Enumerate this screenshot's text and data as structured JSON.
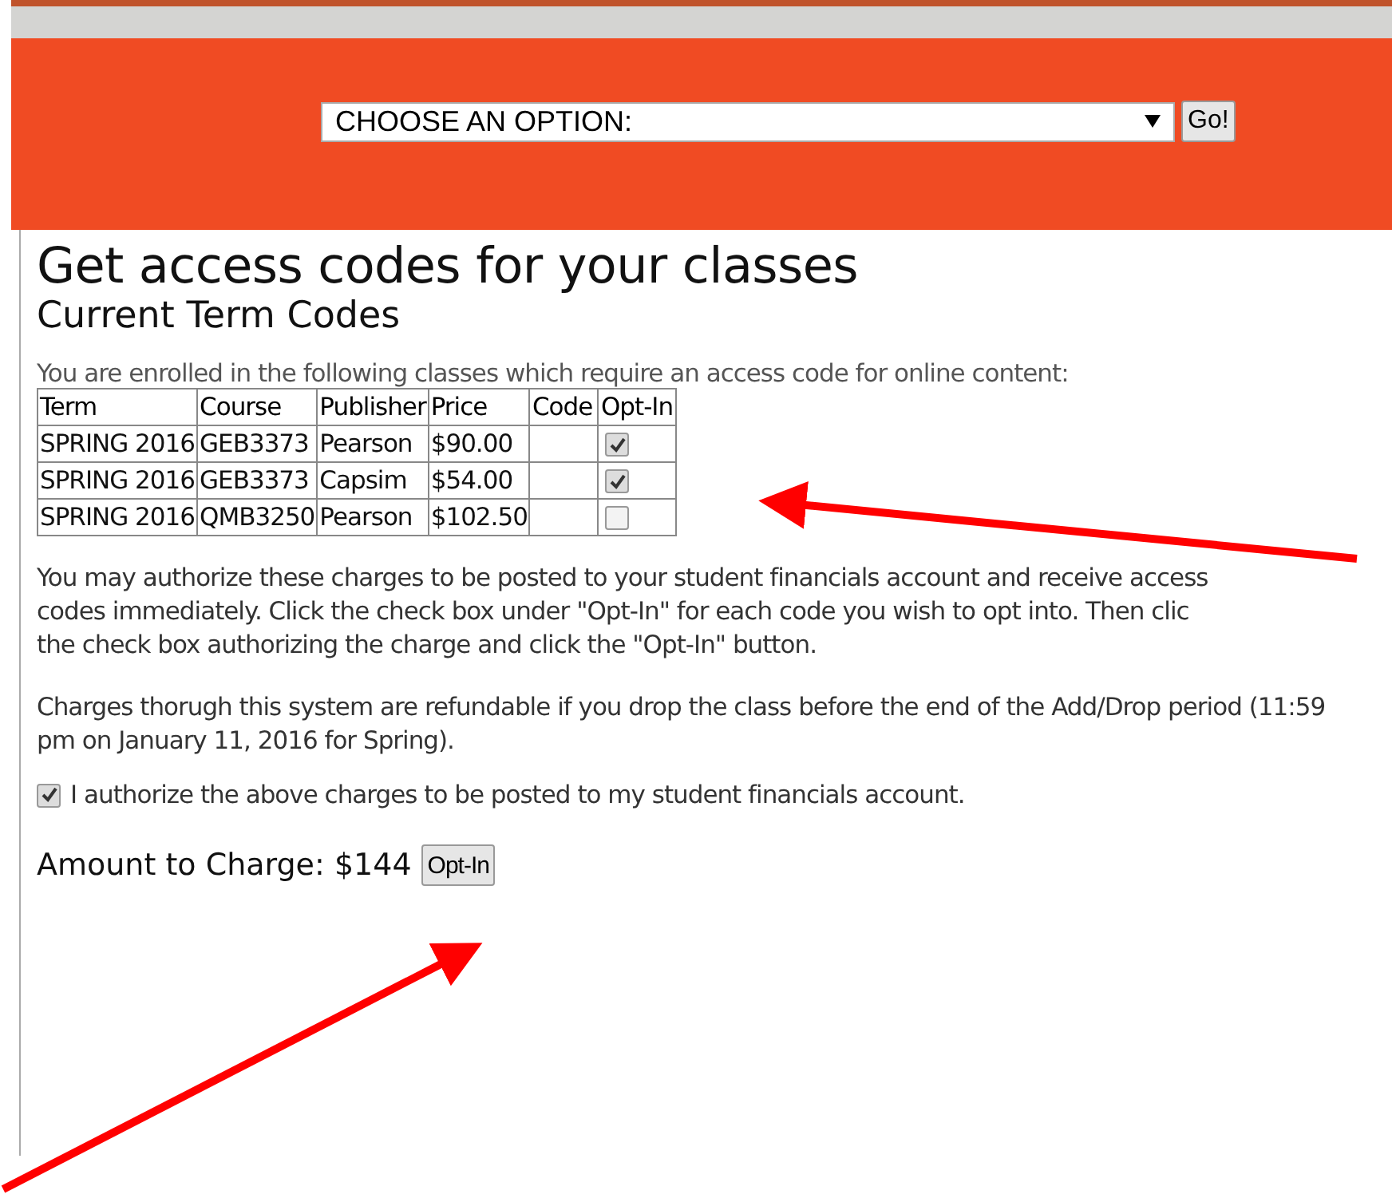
{
  "header": {
    "select": {
      "value": "CHOOSE AN OPTION:"
    },
    "go_button": "Go!"
  },
  "title": "Get access codes for your classes",
  "subtitle": "Current Term Codes",
  "intro": "You are enrolled in the following classes which require an access code for online content:",
  "table": {
    "columns": [
      "Term",
      "Course",
      "Publisher",
      "Price",
      "Code",
      "Opt-In"
    ],
    "rows": [
      {
        "term": "SPRING 2016",
        "course": "GEB3373",
        "publisher": "Pearson",
        "price": "$90.00",
        "checked": true
      },
      {
        "term": "SPRING 2016",
        "course": "GEB3373",
        "publisher": "Capsim",
        "price": "$54.00",
        "checked": true
      },
      {
        "term": "SPRING 2016",
        "course": "QMB3250",
        "publisher": "Pearson",
        "price": "$102.50",
        "checked": false
      }
    ]
  },
  "instructions": [
    "You may authorize these charges to be posted to your student financials account and receive access",
    "codes immediately. Click the check box under \"Opt-In\" for each code you wish to opt into. Then clic",
    "the check box authorizing the charge and click the \"Opt-In\" button."
  ],
  "refund_note": "Charges thorugh this system are refundable if you drop the class before the end of the Add/Drop period (11:59 pm on January 11, 2016 for Spring).",
  "authorize": {
    "label": "I authorize the above charges to be posted to my student financials account.",
    "checked": true
  },
  "amount": "Amount to Charge: $144",
  "opt_in_button": "Opt-In"
}
